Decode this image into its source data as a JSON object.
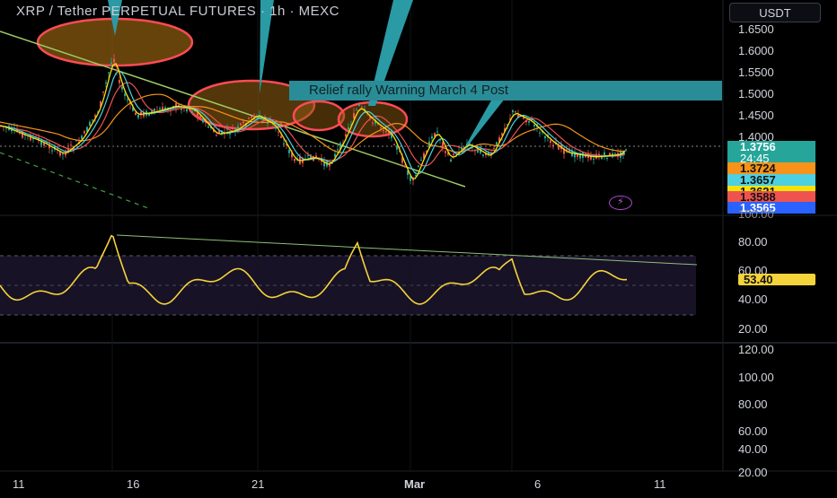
{
  "header": {
    "title": "XRP / Tether PERPETUAL FUTURES · 1h · MEXC",
    "currency": "USDT"
  },
  "annotation": {
    "callout_text": "Relief rally Warning March 4  Post"
  },
  "price_axis": {
    "ticks": [
      "1.6500",
      "1.6000",
      "1.5500",
      "1.5000",
      "1.4500",
      "1.4000"
    ]
  },
  "price_badges": [
    {
      "label": "1.3756",
      "sub": "24:45",
      "color": "#26a69a",
      "text_color": "#ffffff"
    },
    {
      "label": "1.3724",
      "color": "#f7931a",
      "text_color": "#111111"
    },
    {
      "label": "1.3657",
      "color": "#4dd0e1",
      "text_color": "#111111"
    },
    {
      "label": "1.3621",
      "color": "#f5e20d",
      "text_color": "#111111"
    },
    {
      "label": "1.3588",
      "color": "#ef5350",
      "text_color": "#111111"
    },
    {
      "label": "1.3565",
      "color": "#2962ff",
      "text_color": "#ffffff"
    }
  ],
  "rsi_pane": {
    "ticks": [
      "100.00",
      "80.00",
      "60.00",
      "40.00",
      "20.00"
    ],
    "current_value": "53.40",
    "line_color": "#f5d33b"
  },
  "lower_pane": {
    "ticks": [
      "120.00",
      "100.00",
      "80.00",
      "60.00",
      "40.00",
      "20.00"
    ]
  },
  "time_axis": {
    "labels": [
      "11",
      "16",
      "21",
      "Mar",
      "6",
      "11"
    ]
  },
  "icons": {
    "alert": "lightning-alert-icon"
  }
}
